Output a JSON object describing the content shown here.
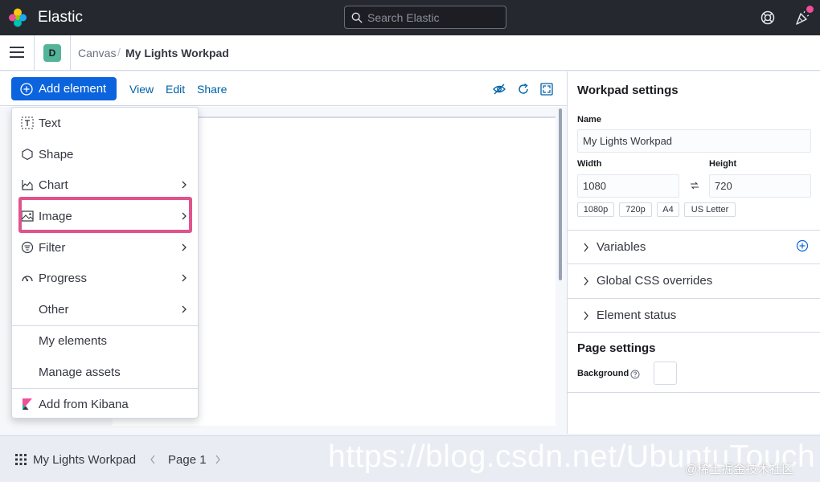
{
  "header": {
    "brand": "Elastic",
    "search_placeholder": "Search Elastic"
  },
  "breadcrumbs": {
    "space_initial": "D",
    "items": [
      "Canvas",
      "My Lights Workpad"
    ],
    "separator": "/"
  },
  "toolbar": {
    "add_element_label": "Add element",
    "links": [
      "View",
      "Edit",
      "Share"
    ]
  },
  "add_element_menu": {
    "items": [
      {
        "label": "Text",
        "icon": "text-icon",
        "submenu": false
      },
      {
        "label": "Shape",
        "icon": "hexagon-icon",
        "submenu": false
      },
      {
        "label": "Chart",
        "icon": "chart-icon",
        "submenu": true
      },
      {
        "label": "Image",
        "icon": "image-icon",
        "submenu": true,
        "highlighted": true
      },
      {
        "label": "Filter",
        "icon": "filter-icon",
        "submenu": true
      },
      {
        "label": "Progress",
        "icon": "gauge-icon",
        "submenu": true
      },
      {
        "label": "Other",
        "icon": "",
        "submenu": true
      },
      {
        "label": "My elements",
        "icon": "",
        "submenu": false
      },
      {
        "label": "Manage assets",
        "icon": "",
        "submenu": false
      },
      {
        "label": "Add from Kibana",
        "icon": "kibana-icon",
        "submenu": false
      }
    ],
    "highlight_color": "#e0538c"
  },
  "workpad_settings": {
    "title": "Workpad settings",
    "name_label": "Name",
    "name_value": "My Lights Workpad",
    "width_label": "Width",
    "width_value": "1080",
    "height_label": "Height",
    "height_value": "720",
    "presets": [
      "1080p",
      "720p",
      "A4",
      "US Letter"
    ],
    "sections": [
      "Variables",
      "Global CSS overrides",
      "Element status"
    ]
  },
  "page_settings": {
    "title": "Page settings",
    "background_label": "Background",
    "background_color": "#ffffff"
  },
  "footer": {
    "workpad_name": "My Lights Workpad",
    "page_label": "Page 1"
  },
  "watermark": {
    "url": "https://blog.csdn.net/UbuntuTouch",
    "credit": "@稀土掘金技术社区"
  },
  "colors": {
    "primary": "#0b64dd",
    "header_bg": "#25282f",
    "link": "#0061a6",
    "notification": "#f04e98"
  }
}
